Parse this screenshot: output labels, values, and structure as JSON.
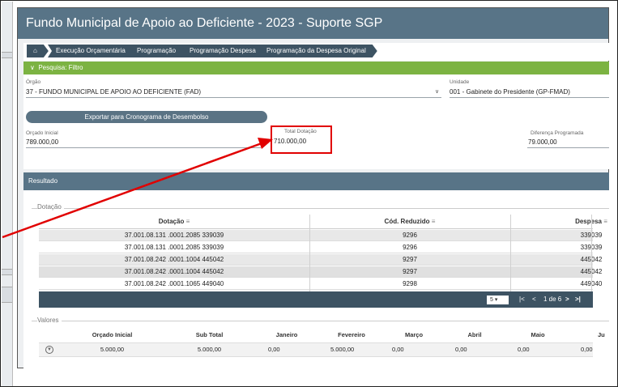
{
  "app": {
    "title": "Fundo Municipal de Apoio ao Deficiente - 2023 - Suporte SGP"
  },
  "breadcrumb": [
    "Execução Orçamentária",
    "Programação",
    "Programação Despesa",
    "Programação da Despesa Original"
  ],
  "filter": {
    "header": "Pesquisa: Filtro",
    "orgao_label": "Órgão",
    "orgao_value": "37 - FUNDO MUNICIPAL DE APOIO AO DEFICIENTE (FAD)",
    "unidade_label": "Unidade",
    "unidade_value": "001 - Gabinete do Presidente (GP-FMAD)",
    "export_label": "Exportar para Cronograma de Desembolso",
    "orcado_label": "Orçado Inicial",
    "orcado_value": "789.000,00",
    "total_label": "Total Dotação",
    "total_value": "710.000,00",
    "diferenca_label": "Diferença Programada",
    "diferenca_value": "79.000,00"
  },
  "resultado": {
    "header": "Resultado",
    "dotacao_group": "Dotação",
    "columns": [
      "Dotação",
      "Cód. Reduzido",
      "Despesa"
    ],
    "rows": [
      [
        "37.001.08.131 .0001.2085 339039",
        "9296",
        "339039"
      ],
      [
        "37.001.08.131 .0001.2085 339039",
        "9296",
        "339039"
      ],
      [
        "37.001.08.242 .0001.1004 445042",
        "9297",
        "445042"
      ],
      [
        "37.001.08.242 .0001.1004 445042",
        "9297",
        "445042"
      ],
      [
        "37.001.08.242 .0001.1065 449040",
        "9298",
        "449040"
      ]
    ],
    "pager": {
      "page_size": "5",
      "page_info": "1 de 6"
    }
  },
  "valores": {
    "group": "Valores",
    "columns": [
      "Orçado Inicial",
      "Sub Total",
      "Janeiro",
      "Fevereiro",
      "Março",
      "Abril",
      "Maio",
      "Ju"
    ],
    "row": [
      "5.000,00",
      "5.000,00",
      "0,00",
      "5.000,00",
      "0,00",
      "0,00",
      "0,00",
      "0,00"
    ]
  },
  "colors": {
    "titlebar": "#587487",
    "green": "#7cb342",
    "highlight": "#e10000",
    "dark": "#3d5363"
  }
}
